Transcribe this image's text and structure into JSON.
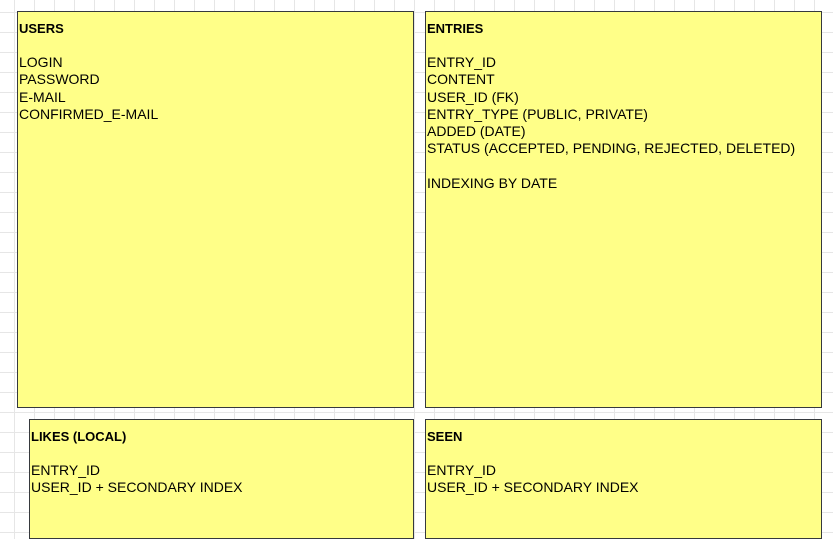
{
  "boxes": [
    {
      "title": "USERS",
      "fields": [
        "LOGIN",
        "PASSWORD",
        "E-MAIL",
        "CONFIRMED_E-MAIL"
      ]
    },
    {
      "title": "ENTRIES",
      "fields": [
        "ENTRY_ID",
        "CONTENT",
        "USER_ID (FK)",
        "ENTRY_TYPE (PUBLIC, PRIVATE)",
        "ADDED (DATE)",
        "STATUS (ACCEPTED, PENDING, REJECTED, DELETED)"
      ],
      "note": "INDEXING BY DATE"
    },
    {
      "title": "LIKES (LOCAL)",
      "fields": [
        "ENTRY_ID",
        "USER_ID + SECONDARY INDEX"
      ]
    },
    {
      "title": "SEEN",
      "fields": [
        "ENTRY_ID",
        "USER_ID + SECONDARY INDEX"
      ]
    }
  ],
  "colors": {
    "note_fill": "#ffff88",
    "note_border": "#36393d",
    "grid_line": "#e6e6e6"
  }
}
